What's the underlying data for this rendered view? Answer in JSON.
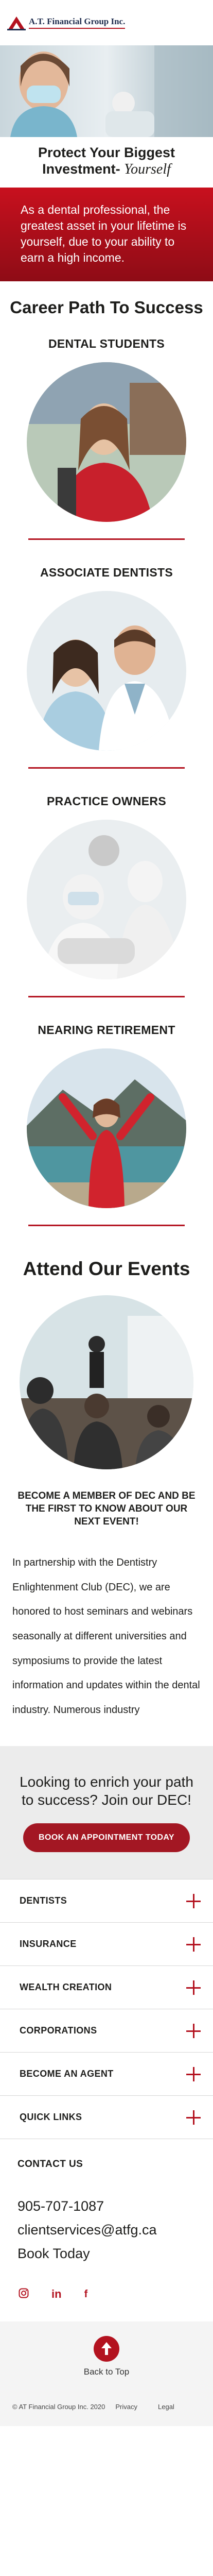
{
  "header": {
    "logo_text": "A.T. Financial Group Inc."
  },
  "hero": {
    "headline_line1": "Protect Your Biggest",
    "headline_line2": "Investment-",
    "headline_accent": "Yourself",
    "band_text": "As a dental professional, the greatest asset in your lifetime is yourself, due to your ability to earn a high income."
  },
  "career_path": {
    "title": "Career Path To Success",
    "stages": [
      {
        "label": "DENTAL STUDENTS"
      },
      {
        "label": "ASSOCIATE DENTISTS"
      },
      {
        "label": "PRACTICE OWNERS"
      },
      {
        "label": "NEARING RETIREMENT"
      }
    ]
  },
  "events": {
    "title": "Attend Our Events",
    "member_cta": "BECOME A MEMBER OF DEC AND BE THE FIRST TO KNOW ABOUT OUR NEXT EVENT!",
    "body": "In partnership with the Dentistry Enlightenment Club (DEC), we are honored to host seminars and webinars seasonally at different universities and symposiums to provide the latest information and updates within the dental industry. Numerous industry"
  },
  "appointment": {
    "heading": "Looking to enrich your path to success? Join our DEC!",
    "button_label": "BOOK  AN APPOINTMENT TODAY"
  },
  "accordion": {
    "items": [
      {
        "label": "DENTISTS"
      },
      {
        "label": "INSURANCE"
      },
      {
        "label": "WEALTH CREATION"
      },
      {
        "label": "CORPORATIONS"
      },
      {
        "label": "BECOME AN AGENT"
      },
      {
        "label": "QUICK LINKS"
      }
    ]
  },
  "contact": {
    "heading": "CONTACT US",
    "phone": "905-707-1087",
    "email": "clientservices@atfg.ca",
    "book": "Book Today"
  },
  "social": {
    "icons": [
      "instagram-icon",
      "linkedin-icon",
      "facebook-icon"
    ],
    "linkedin_glyph": "in",
    "facebook_glyph": "f"
  },
  "back_to_top": {
    "label": "Back to Top"
  },
  "footer": {
    "copyright": "© AT Financial Group Inc. 2020",
    "privacy": "Privacy",
    "legal": "Legal"
  },
  "colors": {
    "brand_red": "#b3121f",
    "navy": "#1f2d4e"
  }
}
